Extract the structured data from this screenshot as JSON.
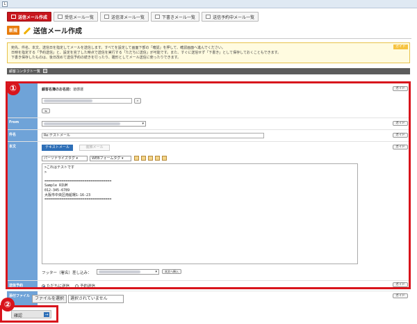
{
  "window": {
    "icon_label": "L"
  },
  "tabs": [
    {
      "label": "送信メール作成",
      "active": true
    },
    {
      "label": "受信メール一覧"
    },
    {
      "label": "送信済メール一覧"
    },
    {
      "label": "下書きメール一覧"
    },
    {
      "label": "送信予約中メール一覧"
    }
  ],
  "header": {
    "badge": "新規",
    "title": "送信メール作成"
  },
  "notice": {
    "guide": "ガイド",
    "lines": [
      "宛先、件名、本文、送信日を指定してメールを送信します。すべてを設定して画面下部の「確認」を押して、確認画面へ進んでください。",
      "日時を指定する「予約送信」と、設定を完了した時点で送信を実行する「ただちに送信」が可能です。また、すぐに送信せず「下書き」として保存しておくこともできます。",
      "下書き保存したものは、後日改めて送信予約の続きを行ったり、雛形としてメール送信に使ったりできます。"
    ]
  },
  "section_bar": {
    "label": "顧客コンタクト一覧"
  },
  "form": {
    "guide_label": "ガイド",
    "recipient_heading": "顧客名簿のお名前：",
    "recipient_name": "道感運",
    "recipient_small_btn": "⇆",
    "from_label": "From",
    "subject_label": "件名",
    "subject_value": "Re:テストメール",
    "body_label": "本文",
    "text_mail_tab": "テキストメール",
    "html_mail_tab": "装飾メール",
    "personalize_tag": "パーソナライズタグ ▾",
    "webform_tag": "WEBフォームタグ ▾",
    "body_text": ">これはテストです\n>\n\n================================\nSample RIUM\n012-345-6789\n大阪市中央区南船場1-16-23\n================================",
    "footer_label": "フッター（署名）差し込み：",
    "footer_btn": "本文へ挿入",
    "send_label": "送信予約",
    "send_now": "ただちに送信",
    "send_reserve": "予約送信",
    "attach_label": "添付ファイル",
    "file_button": "ファイルを選択",
    "file_status": "選択されていません"
  },
  "annotations": {
    "one": "①",
    "two": "②"
  },
  "submit": {
    "label": "確認",
    "arrow": "→"
  },
  "colors": {
    "accent_red": "#d8141c",
    "label_blue": "#6fa3d8",
    "tab_red": "#c8161d"
  }
}
